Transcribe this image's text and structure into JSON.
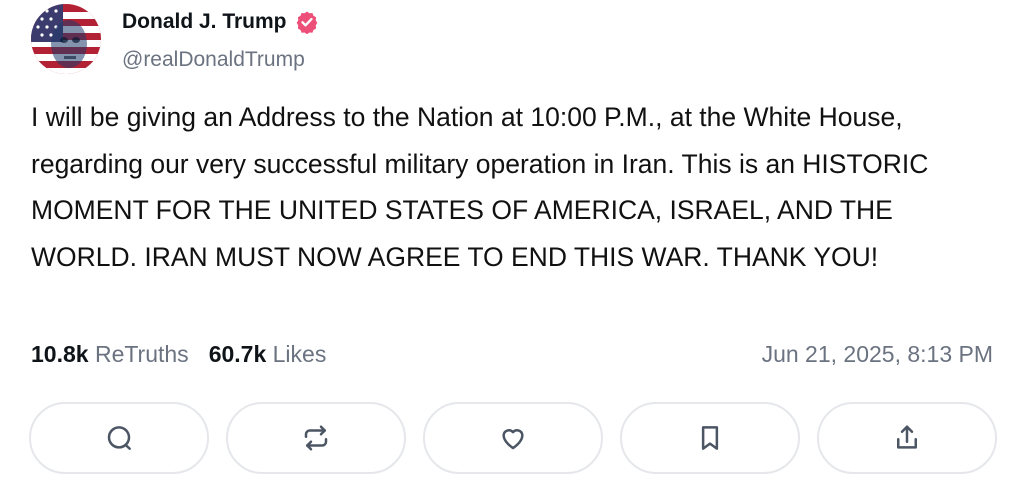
{
  "post": {
    "author": {
      "display_name": "Donald J. Trump",
      "handle": "@realDonaldTrump",
      "verified": true,
      "avatar_icon": "flag-portrait-avatar"
    },
    "text": "I will be giving an Address to the Nation at 10:00 P.M., at the White House, regarding our very successful military operation in Iran. This is an HISTORIC MOMENT FOR THE UNITED STATES OF AMERICA, ISRAEL, AND THE WORLD. IRAN MUST NOW AGREE TO END THIS WAR. THANK YOU!",
    "stats": {
      "retruths_count": "10.8k",
      "retruths_label": "ReTruths",
      "likes_count": "60.7k",
      "likes_label": "Likes"
    },
    "timestamp": "Jun 21, 2025, 8:13 PM"
  },
  "actions": [
    {
      "name": "reply",
      "icon": "comment-icon"
    },
    {
      "name": "retruth",
      "icon": "repost-icon"
    },
    {
      "name": "like",
      "icon": "heart-icon"
    },
    {
      "name": "bookmark",
      "icon": "bookmark-icon"
    },
    {
      "name": "share",
      "icon": "share-icon"
    }
  ],
  "colors": {
    "verified_badge": "#ec4f78",
    "muted_text": "#6b7280",
    "button_border": "#e5e7eb"
  }
}
